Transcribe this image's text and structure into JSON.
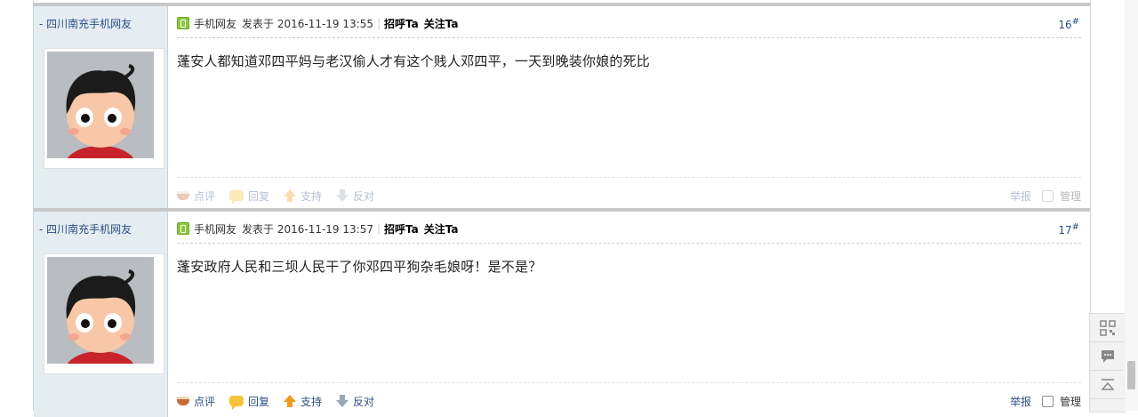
{
  "posts": [
    {
      "author": "- 四川南充手机网友",
      "via": "手机网友",
      "posted": "发表于 2016-11-19 13:55",
      "greet": "招呼Ta",
      "follow": "关注Ta",
      "floor": "16",
      "floor_mark": "#",
      "message": "蓬安人都知道邓四平妈与老汉偷人才有这个贱人邓四平，一天到晚装你娘的死比",
      "actions": {
        "comment": "点评",
        "reply": "回复",
        "support": "支持",
        "oppose": "反对",
        "report": "举报",
        "manage": "管理"
      }
    },
    {
      "author": "- 四川南充手机网友",
      "via": "手机网友",
      "posted": "发表于 2016-11-19 13:57",
      "greet": "招呼Ta",
      "follow": "关注Ta",
      "floor": "17",
      "floor_mark": "#",
      "message": "蓬安政府人民和三坝人民干了你邓四平狗杂毛娘呀！是不是？",
      "actions": {
        "comment": "点评",
        "reply": "回复",
        "support": "支持",
        "oppose": "反对",
        "report": "举报",
        "manage": "管理"
      }
    }
  ],
  "sidebar": {
    "icons": [
      "qrcode-icon",
      "comment-icon",
      "back-to-top-icon"
    ]
  },
  "colors": {
    "link": "#2b4f86",
    "author_bg": "#e5edf2",
    "border": "#c2d5e3"
  }
}
